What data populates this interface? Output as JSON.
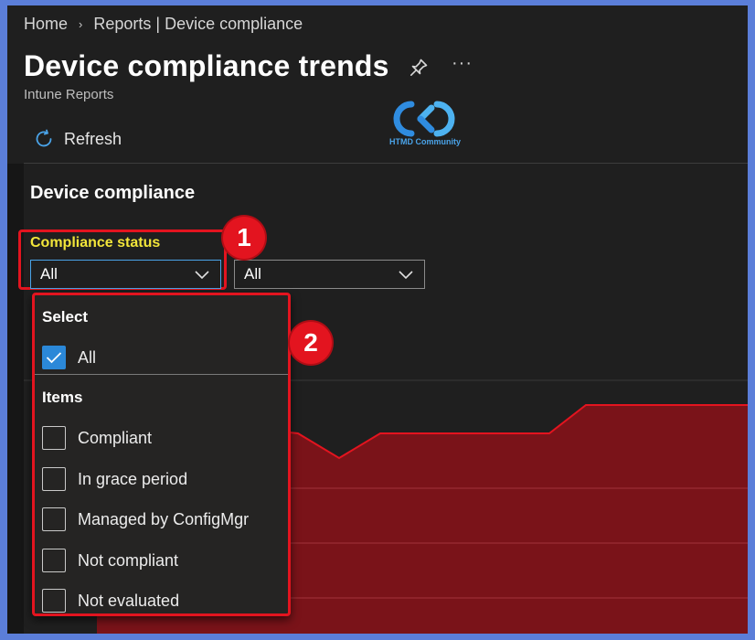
{
  "breadcrumb": {
    "home": "Home",
    "current": "Reports | Device compliance",
    "separator": "›"
  },
  "header": {
    "title": "Device compliance trends",
    "subtitle": "Intune Reports",
    "more": "···"
  },
  "watermark": {
    "text": "HTMD Community"
  },
  "toolbar": {
    "refresh_label": "Refresh"
  },
  "section": {
    "title": "Device compliance"
  },
  "filters": {
    "compliance_status": {
      "label": "Compliance status",
      "value": "All"
    },
    "second": {
      "value": "All"
    }
  },
  "annotations": {
    "one": "1",
    "two": "2"
  },
  "dropdown": {
    "select_heading": "Select",
    "all_option": {
      "label": "All",
      "checked": true
    },
    "items_heading": "Items",
    "items": [
      {
        "label": "Compliant",
        "checked": false
      },
      {
        "label": "In grace period",
        "checked": false
      },
      {
        "label": "Managed by ConfigMgr",
        "checked": false
      },
      {
        "label": "Not compliant",
        "checked": false
      },
      {
        "label": "Not evaluated",
        "checked": false
      }
    ]
  },
  "colors": {
    "accent": "#2b88d8",
    "annotation": "#e3141f",
    "highlight_label": "#f2e53a",
    "chart_fill": "#7a1319",
    "chart_line": "#e3141f"
  }
}
